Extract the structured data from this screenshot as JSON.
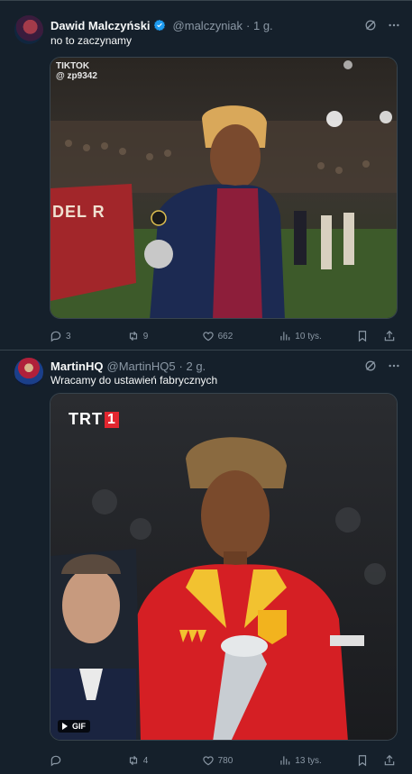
{
  "tweets": [
    {
      "name": "Dawid Malczyński",
      "handle": "@malczyniak",
      "time": "· 1 g.",
      "text": "no to zaczynamy",
      "media": {
        "kind": "video",
        "overlay_title": "TIKTOK",
        "overlay_user": "@ zp9342",
        "banner_text": "DEL R"
      },
      "stats": {
        "replies": "3",
        "retweets": "9",
        "likes": "662",
        "views": "10 tys."
      }
    },
    {
      "name": "MartinHQ",
      "handle": "@MartinHQ5",
      "time": "· 2 g.",
      "text": "Wracamy do ustawień fabrycznych",
      "media": {
        "kind": "gif",
        "logo": "TRT",
        "logo_num": "1",
        "badge": "GIF"
      },
      "stats": {
        "replies": "",
        "retweets": "4",
        "likes": "780",
        "views": "13 tys."
      }
    }
  ],
  "colors": {
    "background": "#15202b",
    "border": "#38444d",
    "muted": "#8b98a5",
    "verified": "#1d9bf0"
  }
}
